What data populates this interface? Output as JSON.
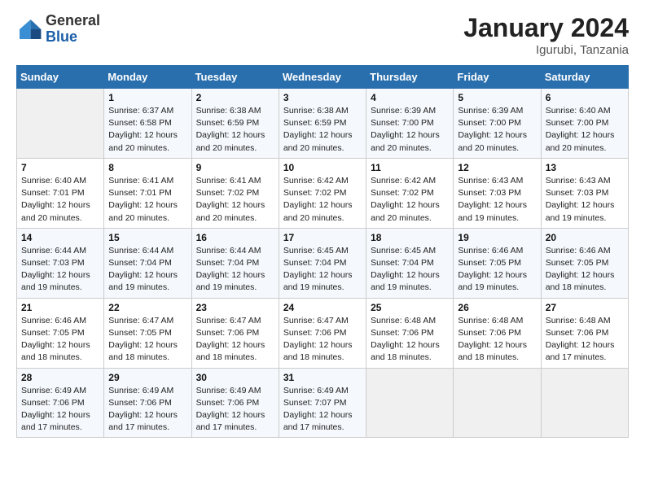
{
  "logo": {
    "general": "General",
    "blue": "Blue"
  },
  "header": {
    "title": "January 2024",
    "subtitle": "Igurubi, Tanzania"
  },
  "weekdays": [
    "Sunday",
    "Monday",
    "Tuesday",
    "Wednesday",
    "Thursday",
    "Friday",
    "Saturday"
  ],
  "weeks": [
    [
      {
        "day": "",
        "info": ""
      },
      {
        "day": "1",
        "info": "Sunrise: 6:37 AM\nSunset: 6:58 PM\nDaylight: 12 hours\nand 20 minutes."
      },
      {
        "day": "2",
        "info": "Sunrise: 6:38 AM\nSunset: 6:59 PM\nDaylight: 12 hours\nand 20 minutes."
      },
      {
        "day": "3",
        "info": "Sunrise: 6:38 AM\nSunset: 6:59 PM\nDaylight: 12 hours\nand 20 minutes."
      },
      {
        "day": "4",
        "info": "Sunrise: 6:39 AM\nSunset: 7:00 PM\nDaylight: 12 hours\nand 20 minutes."
      },
      {
        "day": "5",
        "info": "Sunrise: 6:39 AM\nSunset: 7:00 PM\nDaylight: 12 hours\nand 20 minutes."
      },
      {
        "day": "6",
        "info": "Sunrise: 6:40 AM\nSunset: 7:00 PM\nDaylight: 12 hours\nand 20 minutes."
      }
    ],
    [
      {
        "day": "7",
        "info": "Sunrise: 6:40 AM\nSunset: 7:01 PM\nDaylight: 12 hours\nand 20 minutes."
      },
      {
        "day": "8",
        "info": "Sunrise: 6:41 AM\nSunset: 7:01 PM\nDaylight: 12 hours\nand 20 minutes."
      },
      {
        "day": "9",
        "info": "Sunrise: 6:41 AM\nSunset: 7:02 PM\nDaylight: 12 hours\nand 20 minutes."
      },
      {
        "day": "10",
        "info": "Sunrise: 6:42 AM\nSunset: 7:02 PM\nDaylight: 12 hours\nand 20 minutes."
      },
      {
        "day": "11",
        "info": "Sunrise: 6:42 AM\nSunset: 7:02 PM\nDaylight: 12 hours\nand 20 minutes."
      },
      {
        "day": "12",
        "info": "Sunrise: 6:43 AM\nSunset: 7:03 PM\nDaylight: 12 hours\nand 19 minutes."
      },
      {
        "day": "13",
        "info": "Sunrise: 6:43 AM\nSunset: 7:03 PM\nDaylight: 12 hours\nand 19 minutes."
      }
    ],
    [
      {
        "day": "14",
        "info": "Sunrise: 6:44 AM\nSunset: 7:03 PM\nDaylight: 12 hours\nand 19 minutes."
      },
      {
        "day": "15",
        "info": "Sunrise: 6:44 AM\nSunset: 7:04 PM\nDaylight: 12 hours\nand 19 minutes."
      },
      {
        "day": "16",
        "info": "Sunrise: 6:44 AM\nSunset: 7:04 PM\nDaylight: 12 hours\nand 19 minutes."
      },
      {
        "day": "17",
        "info": "Sunrise: 6:45 AM\nSunset: 7:04 PM\nDaylight: 12 hours\nand 19 minutes."
      },
      {
        "day": "18",
        "info": "Sunrise: 6:45 AM\nSunset: 7:04 PM\nDaylight: 12 hours\nand 19 minutes."
      },
      {
        "day": "19",
        "info": "Sunrise: 6:46 AM\nSunset: 7:05 PM\nDaylight: 12 hours\nand 19 minutes."
      },
      {
        "day": "20",
        "info": "Sunrise: 6:46 AM\nSunset: 7:05 PM\nDaylight: 12 hours\nand 18 minutes."
      }
    ],
    [
      {
        "day": "21",
        "info": "Sunrise: 6:46 AM\nSunset: 7:05 PM\nDaylight: 12 hours\nand 18 minutes."
      },
      {
        "day": "22",
        "info": "Sunrise: 6:47 AM\nSunset: 7:05 PM\nDaylight: 12 hours\nand 18 minutes."
      },
      {
        "day": "23",
        "info": "Sunrise: 6:47 AM\nSunset: 7:06 PM\nDaylight: 12 hours\nand 18 minutes."
      },
      {
        "day": "24",
        "info": "Sunrise: 6:47 AM\nSunset: 7:06 PM\nDaylight: 12 hours\nand 18 minutes."
      },
      {
        "day": "25",
        "info": "Sunrise: 6:48 AM\nSunset: 7:06 PM\nDaylight: 12 hours\nand 18 minutes."
      },
      {
        "day": "26",
        "info": "Sunrise: 6:48 AM\nSunset: 7:06 PM\nDaylight: 12 hours\nand 18 minutes."
      },
      {
        "day": "27",
        "info": "Sunrise: 6:48 AM\nSunset: 7:06 PM\nDaylight: 12 hours\nand 17 minutes."
      }
    ],
    [
      {
        "day": "28",
        "info": "Sunrise: 6:49 AM\nSunset: 7:06 PM\nDaylight: 12 hours\nand 17 minutes."
      },
      {
        "day": "29",
        "info": "Sunrise: 6:49 AM\nSunset: 7:06 PM\nDaylight: 12 hours\nand 17 minutes."
      },
      {
        "day": "30",
        "info": "Sunrise: 6:49 AM\nSunset: 7:06 PM\nDaylight: 12 hours\nand 17 minutes."
      },
      {
        "day": "31",
        "info": "Sunrise: 6:49 AM\nSunset: 7:07 PM\nDaylight: 12 hours\nand 17 minutes."
      },
      {
        "day": "",
        "info": ""
      },
      {
        "day": "",
        "info": ""
      },
      {
        "day": "",
        "info": ""
      }
    ]
  ]
}
